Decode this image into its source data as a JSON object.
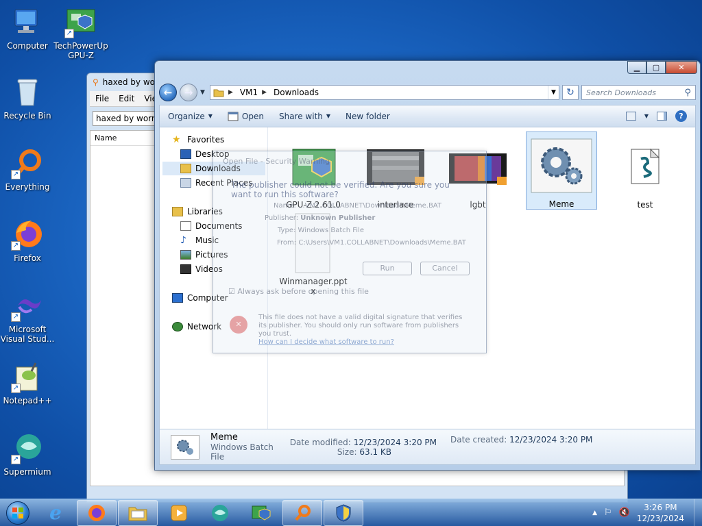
{
  "desktop": {
    "icons": [
      {
        "label": "Computer"
      },
      {
        "label": "TechPowerUp GPU-Z"
      },
      {
        "label": "Recycle Bin"
      },
      {
        "label": "Everything"
      },
      {
        "label": "Firefox"
      },
      {
        "label": "Microsoft Visual Stud..."
      },
      {
        "label": "Notepad++"
      },
      {
        "label": "Supermium"
      }
    ]
  },
  "bg_window": {
    "title": "haxed by wor",
    "menu": [
      "File",
      "Edit",
      "Vie"
    ],
    "combo_value": "haxed by wormer",
    "column": "Name"
  },
  "explorer": {
    "breadcrumb": [
      "VM1",
      "Downloads"
    ],
    "search_placeholder": "Search Downloads",
    "toolbar": {
      "organize": "Organize",
      "open": "Open",
      "share_with": "Share with",
      "new_folder": "New folder"
    },
    "nav": {
      "favorites": "Favorites",
      "desktop": "Desktop",
      "downloads": "Downloads",
      "recent": "Recent Places",
      "libraries": "Libraries",
      "documents": "Documents",
      "music": "Music",
      "pictures": "Pictures",
      "videos": "Videos",
      "computer": "Computer",
      "network": "Network"
    },
    "files": [
      {
        "name": "GPU-Z.2.61.0"
      },
      {
        "name": "interlace"
      },
      {
        "name": "lgbt"
      },
      {
        "name": "Meme"
      },
      {
        "name": "test"
      },
      {
        "name": "Winmanager.ppt x"
      }
    ],
    "details": {
      "name": "Meme",
      "type": "Windows Batch File",
      "modified_label": "Date modified:",
      "modified": "12/23/2024 3:20 PM",
      "created_label": "Date created:",
      "created": "12/23/2024 3:20 PM",
      "size_label": "Size:",
      "size": "63.1 KB"
    }
  },
  "ghost_dialog": {
    "title": "Open File - Security Warning",
    "headline": "The publisher could not be verified. Are you sure you want to run this software?",
    "name_label": "Name:",
    "name_value": "...VM1.COLLABNET\\Downloads\\Meme.BAT",
    "publisher_label": "Publisher:",
    "publisher_value": "Unknown Publisher",
    "type_label": "Type:",
    "type_value": "Windows Batch File",
    "from_label": "From:",
    "from_value": "C:\\Users\\VM1.COLLABNET\\Downloads\\Meme.BAT",
    "run": "Run",
    "cancel": "Cancel",
    "always_ask": "Always ask before opening this file",
    "footer": "This file does not have a valid digital signature that verifies its publisher. You should only run software from publishers you trust.",
    "footer_link": "How can I decide what software to run?"
  },
  "taskbar": {
    "time": "3:26 PM",
    "date": "12/23/2024"
  }
}
